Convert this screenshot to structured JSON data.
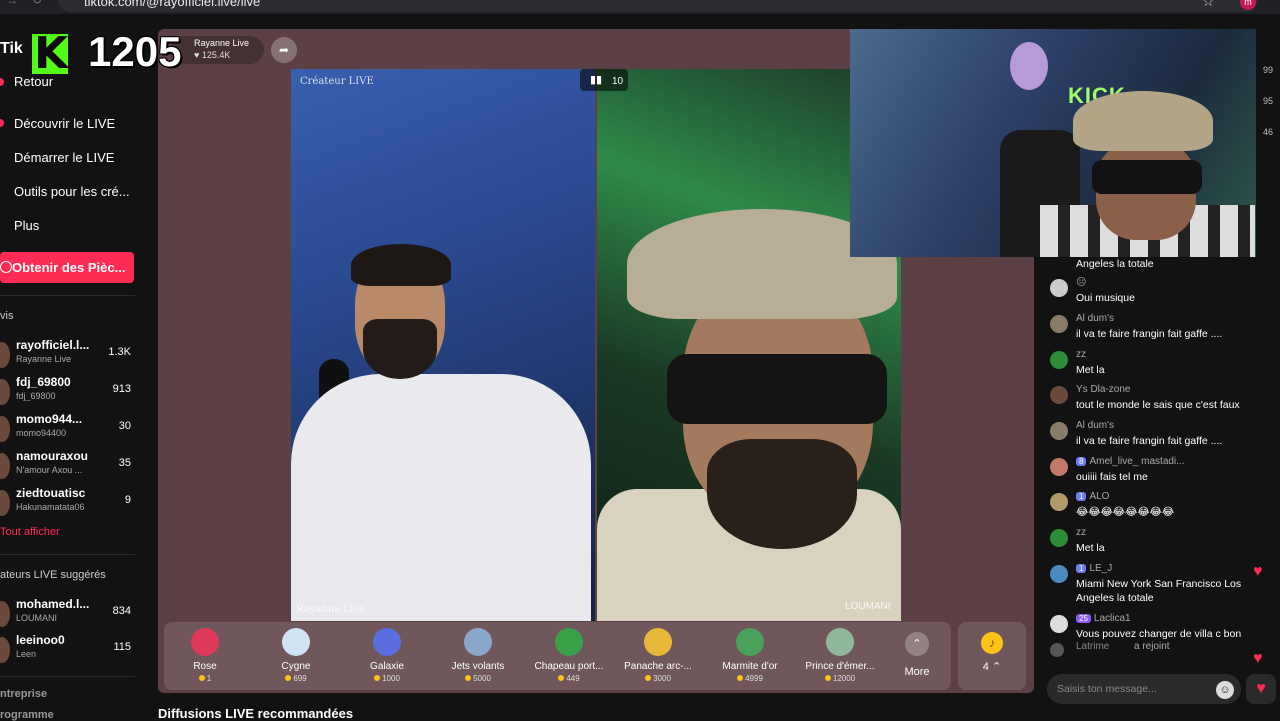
{
  "browser": {
    "url": "tiktok.com/@rayofficiel.live/live"
  },
  "overlay": {
    "tiktok_label": "Tik",
    "kick_letter": "K",
    "kick_count": "1205"
  },
  "sidebar": {
    "menu": [
      {
        "label": "Retour"
      },
      {
        "label": "Découvrir le LIVE"
      },
      {
        "label": "Démarrer le LIVE"
      },
      {
        "label": "Outils pour les cré..."
      },
      {
        "label": "Plus"
      }
    ],
    "coins_button": "Obtenir des Pièc...",
    "following_label": "vis",
    "following": [
      {
        "name": "rayofficiel.l...",
        "sub": "Rayanne Live",
        "count": "1.3K"
      },
      {
        "name": "fdj_69800",
        "sub": "fdj_69800",
        "count": "913"
      },
      {
        "name": "momo944...",
        "sub": "momo94400",
        "count": "30"
      },
      {
        "name": "namouraxou",
        "sub": "N'amour Axou ...",
        "count": "35"
      },
      {
        "name": "ziedtouatisc",
        "sub": "Hakunamatata06",
        "count": "9"
      }
    ],
    "see_all": "Tout afficher",
    "suggested_label": "ateurs LIVE suggérés",
    "suggested": [
      {
        "name": "mohamed.l...",
        "sub": "LOUMANI",
        "count": "834"
      },
      {
        "name": "leeinoo0",
        "sub": "Leen",
        "count": "115"
      }
    ],
    "footer": [
      "ntreprise",
      "rogramme"
    ]
  },
  "stream": {
    "host_name": "Rayanne Live",
    "viewers": "125.4K",
    "left_cam_top_label": "Créateur LIVE",
    "left_cam_bottom_label": "Rayanne Live",
    "right_cam_label": "LOUMANI",
    "sound_number": "10"
  },
  "webcam": {
    "sign": "KICK"
  },
  "gifts": [
    {
      "name": "Rose",
      "price": "1",
      "color": "#e03a5a"
    },
    {
      "name": "Cygne",
      "price": "699",
      "color": "#cfe3f5"
    },
    {
      "name": "Galaxie",
      "price": "1000",
      "color": "#5a6ee0"
    },
    {
      "name": "Jets volants",
      "price": "5000",
      "color": "#8aa6c8"
    },
    {
      "name": "Chapeau port...",
      "price": "449",
      "color": "#3aa04a"
    },
    {
      "name": "Panache arc-...",
      "price": "3000",
      "color": "#e8b83a"
    },
    {
      "name": "Marmite d'or",
      "price": "4999",
      "color": "#4aa25a"
    },
    {
      "name": "Prince d'émer...",
      "price": "12000",
      "color": "#8fb89a"
    }
  ],
  "gift_more": "More",
  "coins_panel": {
    "count": "4"
  },
  "recommended_heading": "Diffusions LIVE recommandées",
  "chat": {
    "side_counts": [
      "99",
      "95",
      "46"
    ],
    "messages": [
      {
        "user": "",
        "badge": "",
        "text": "Angeles la totale",
        "avatar_color": "#555"
      },
      {
        "user": "",
        "badge": "",
        "text": "Oui musique",
        "avatar_color": "#ccc"
      },
      {
        "user": "Al dum's",
        "badge": "",
        "text": "il va te faire frangin fait gaffe ....",
        "avatar_color": "#8a7a6a"
      },
      {
        "user": "zz",
        "badge": "",
        "text": "Met la",
        "avatar_color": "#2e8b3a"
      },
      {
        "user": "Ys Dla-zone",
        "badge": "",
        "text": "tout le monde le sais que c'est faux",
        "avatar_color": "#6a4a3a"
      },
      {
        "user": "Al dum's",
        "badge": "",
        "text": "il va te faire frangin fait gaffe ....",
        "avatar_color": "#8a7a6a"
      },
      {
        "user": "Amel_live_ mastadi...",
        "badge": "8",
        "text": "ouiiii fais tel me",
        "avatar_color": "#c07a6a"
      },
      {
        "user": "ALO",
        "badge": "1",
        "text": "😂😂😂😂😂😂😂😂",
        "avatar_color": "#b09a6a"
      },
      {
        "user": "zz",
        "badge": "",
        "text": "Met la",
        "avatar_color": "#2e8b3a"
      },
      {
        "user": "LE_J",
        "badge": "1",
        "text": "Miami New York San Francisco Los Angeles la totale",
        "avatar_color": "#4a8abf"
      },
      {
        "user": "Laclica1",
        "badge": "25",
        "text": "Vous pouvez changer de villa c bon",
        "avatar_color": "#ddd"
      },
      {
        "user": "Latrime",
        "badge": "",
        "text": "a rejoint",
        "avatar_color": "#555"
      }
    ],
    "input_placeholder": "Saisis ton message..."
  }
}
